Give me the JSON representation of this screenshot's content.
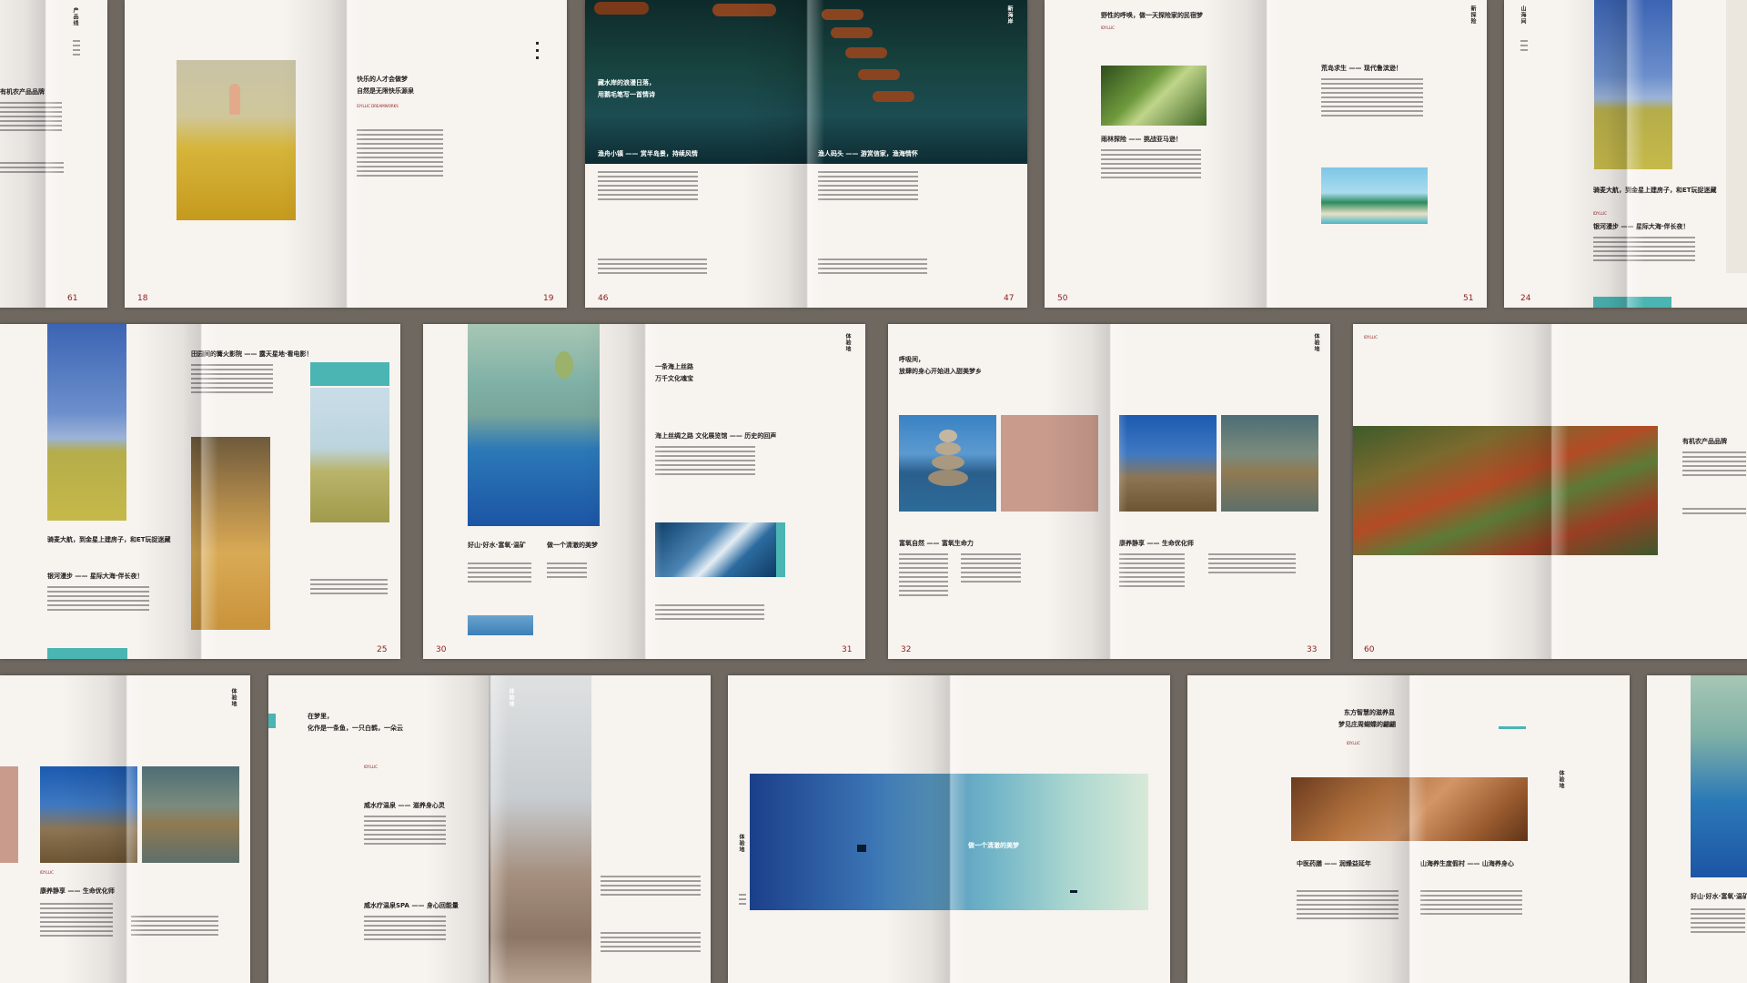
{
  "spreads": [
    {
      "left_page": "",
      "right_page": "61",
      "headline": "有机农产品品牌",
      "vertical": "产品线"
    },
    {
      "left_page": "18",
      "right_page": "19",
      "headline": "快乐的人才会做梦",
      "headline2": "自然是无限快乐源泉",
      "subhead": "IDYLLIC DREAMWORKS"
    },
    {
      "left_page": "46",
      "right_page": "47",
      "headline": "藏水岸的浪漫日落，",
      "headline2": "用鹅毛笔写一首情诗",
      "caption_left": "渔舟小镇 —— 赏半岛景，持续风情",
      "caption_right": "渔人码头 —— 游赏信家，渔海情怀",
      "vertical": "新海岸"
    },
    {
      "left_page": "50",
      "right_page": "51",
      "headline": "野性的呼唤，做一天探险家的民宿梦",
      "sub_left": "雨林探险 —— 挑战亚马逊！",
      "sub_right": "荒岛求生 —— 现代鲁滨逊！",
      "vertical": "新探险"
    },
    {
      "left_page": "24",
      "right_page": "",
      "headline": "骑麦大航，到金星上建房子，和ET玩捉迷藏",
      "sub": "银河漫步 —— 星际大海·伴长夜！",
      "vertical": "山海间"
    },
    {
      "left_page": "",
      "right_page": "25",
      "headline": "骑麦大航，到金星上建房子，和ET玩捉迷藏",
      "sub": "银河漫步 —— 星际大海·伴长夜！",
      "sub2": "田园间的篝火影院 —— 露天星地·看电影！"
    },
    {
      "left_page": "30",
      "right_page": "31",
      "headline": "一条海上丝路",
      "headline2": "万千文化魂宝",
      "sub": "海上丝绸之路 文化展览馆 —— 历史的回声",
      "cap1": "好山·好水·富氧·温矿",
      "cap2": "做一个清澈的美梦",
      "vertical": "体验地"
    },
    {
      "left_page": "32",
      "right_page": "33",
      "headline": "呼吸间，",
      "headline2": "放肆的身心开始进入甜美梦乡",
      "sub_left": "富氧自然 —— 富氧生命力",
      "sub_right": "康养静享 —— 生命优化师",
      "vertical": "体验地"
    },
    {
      "left_page": "",
      "right_page": "60",
      "headline": "有机农产品品牌"
    },
    {
      "left_page": "",
      "right_page": "",
      "sub": "康养静享 —— 生命优化师",
      "vertical": "体验地"
    },
    {
      "left_page": "",
      "right_page": "",
      "headline": "在梦里，",
      "headline2": "化作是一条鱼，一只白鹤，一朵云",
      "sub1": "威水疗温泉 —— 滋养身心灵",
      "sub2": "威水疗温泉SPA —— 身心回能量",
      "vertical": "体验地"
    },
    {
      "left_page": "",
      "right_page": "",
      "caption": "做一个清澈的美梦",
      "vertical": "体验地"
    },
    {
      "left_page": "",
      "right_page": "",
      "headline": "东方智慧的滋养显",
      "headline2": "梦见庄周蝴蝶的翩翩",
      "sub_left": "中医药膳 —— 润燥益延年",
      "sub_right": "山海养生度假村 —— 山海养身心",
      "vertical": "体验地"
    },
    {
      "left_page": "",
      "right_page": "",
      "cap": "好山·好水·富氧·温矿"
    }
  ]
}
